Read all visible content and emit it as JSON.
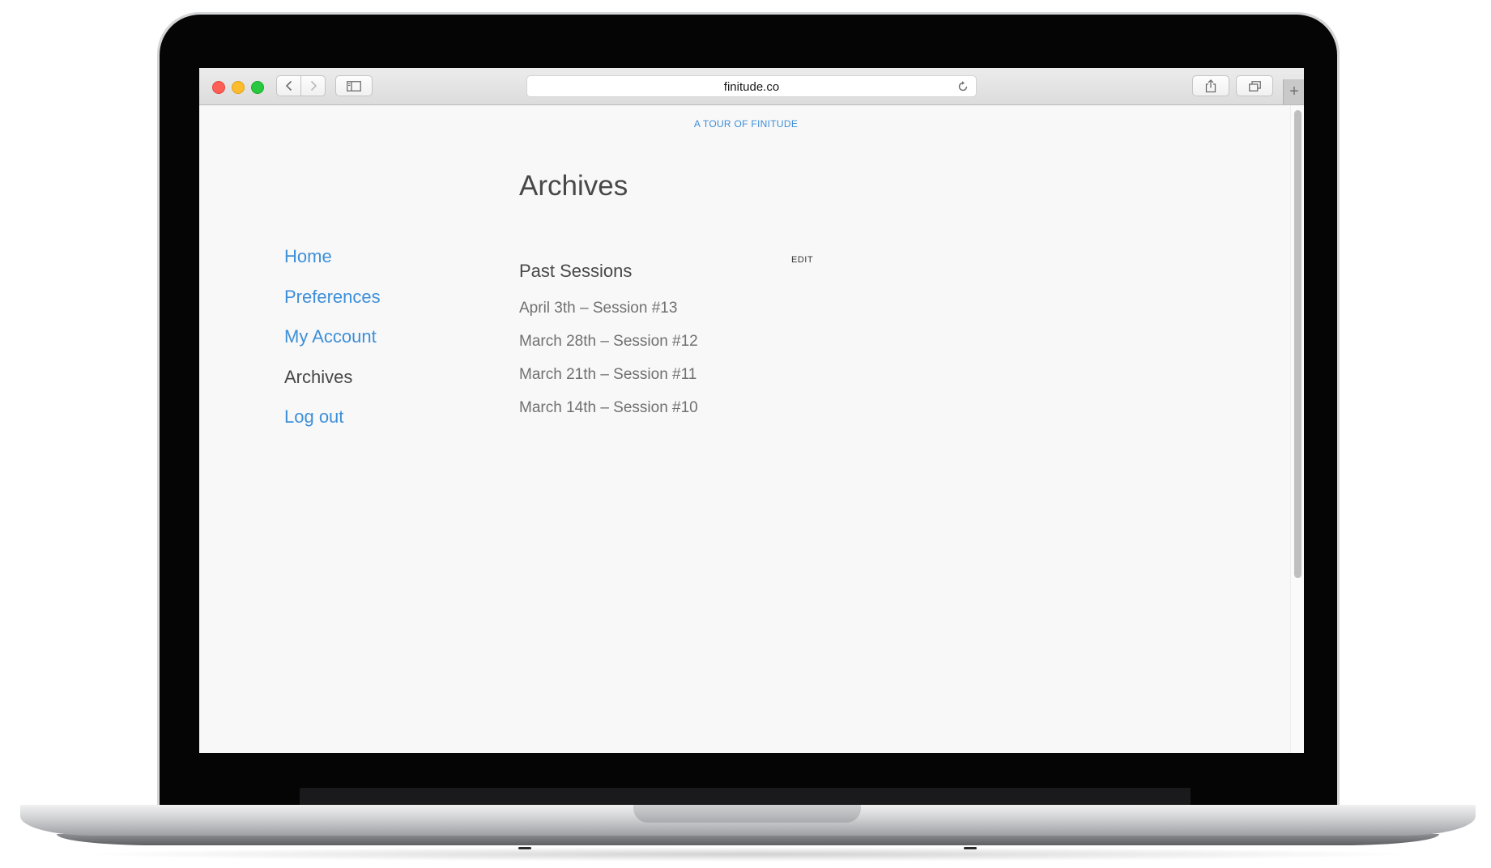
{
  "browser": {
    "url": "finitude.co"
  },
  "page": {
    "tour_link": "A TOUR OF FINITUDE",
    "title": "Archives",
    "nav": [
      {
        "label": "Home",
        "active": false
      },
      {
        "label": "Preferences",
        "active": false
      },
      {
        "label": "My Account",
        "active": false
      },
      {
        "label": "Archives",
        "active": true
      },
      {
        "label": "Log out",
        "active": false
      }
    ],
    "section_title": "Past Sessions",
    "edit_label": "EDIT",
    "sessions": [
      "April 3th – Session #13",
      "March 28th – Session #12",
      "March 21th – Session #11",
      "March 14th – Session #10"
    ]
  },
  "colors": {
    "link": "#3d8fd9",
    "text_dark": "#484848",
    "text_muted": "#707070",
    "page_bg": "#f8f8f8"
  }
}
